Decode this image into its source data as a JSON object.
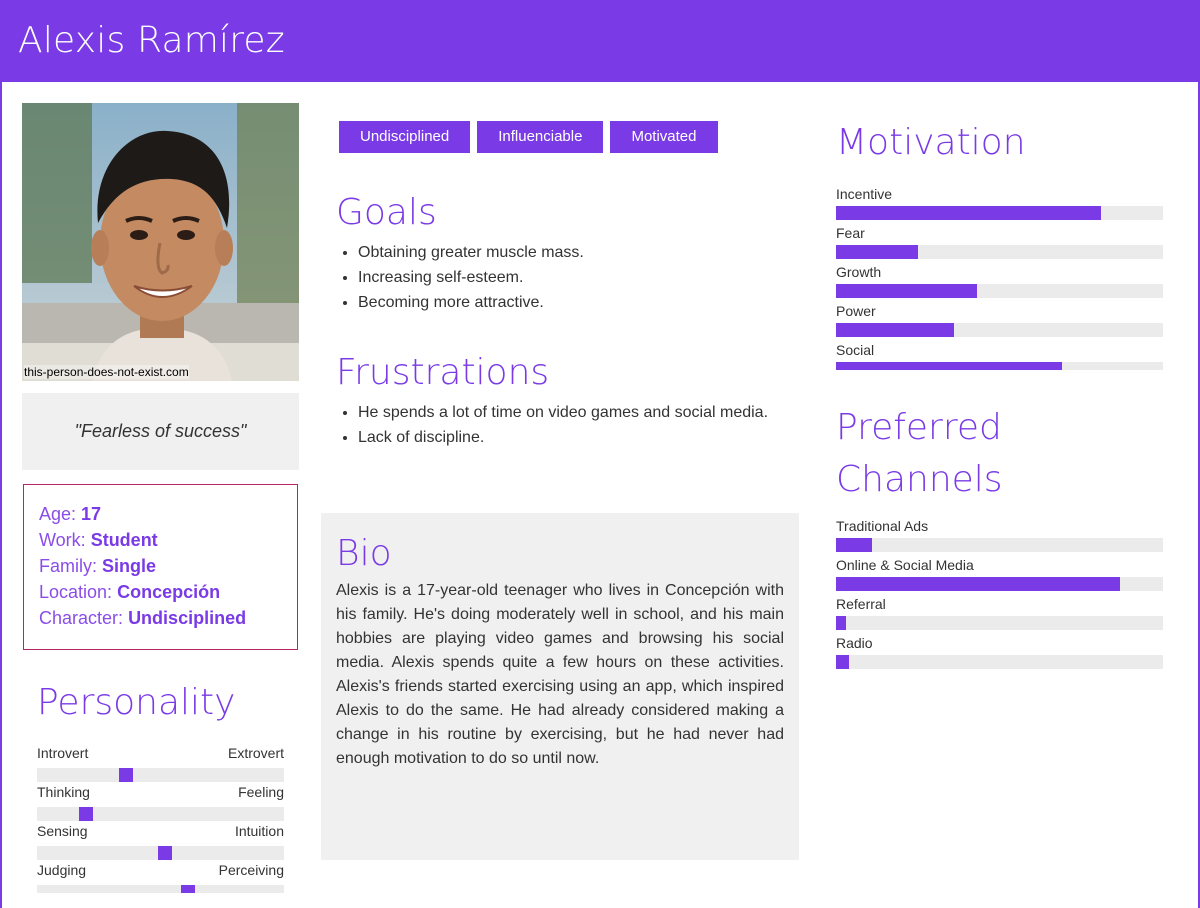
{
  "header": {
    "name": "Alexis Ramírez"
  },
  "photo": {
    "credit": "this-person-does-not-exist.com"
  },
  "quote": "\"Fearless of success\"",
  "facts": [
    {
      "label": "Age:",
      "value": "17"
    },
    {
      "label": "Work:",
      "value": "Student"
    },
    {
      "label": "Family:",
      "value": "Single"
    },
    {
      "label": "Location:",
      "value": "Concepción"
    },
    {
      "label": "Character:",
      "value": "Undisciplined"
    }
  ],
  "personality": {
    "title": "Personality",
    "traits": [
      {
        "left": "Introvert",
        "right": "Extrovert",
        "position": 0.35
      },
      {
        "left": "Thinking",
        "right": "Feeling",
        "position": 0.18
      },
      {
        "left": "Sensing",
        "right": "Intuition",
        "position": 0.52
      },
      {
        "left": "Judging",
        "right": "Perceiving",
        "position": 0.62
      }
    ]
  },
  "tags": [
    "Undisciplined",
    "Influenciable",
    "Motivated"
  ],
  "goals": {
    "title": "Goals",
    "items": [
      "Obtaining greater muscle mass.",
      "Increasing self-esteem.",
      "Becoming more attractive."
    ]
  },
  "frustrations": {
    "title": "Frustrations",
    "items": [
      "He spends a lot of time on video games and social media.",
      "Lack of discipline."
    ]
  },
  "bio": {
    "title": "Bio",
    "text": "Alexis is a 17-year-old teenager who lives in Concepción with his family. He's doing moderately well in school, and his main hobbies are playing video games and browsing his social media. Alexis spends quite a few hours on these activities. Alexis's friends started exercising using an app, which inspired Alexis to do the same. He had already considered making a change in his routine by exercising, but he had never had enough motivation to do so until now."
  },
  "motivation": {
    "title": "Motivation",
    "items": [
      {
        "label": "Incentive",
        "value": 0.81
      },
      {
        "label": "Fear",
        "value": 0.25
      },
      {
        "label": "Growth",
        "value": 0.43
      },
      {
        "label": "Power",
        "value": 0.36
      },
      {
        "label": "Social",
        "value": 0.69
      }
    ]
  },
  "channels": {
    "title": "Preferred Channels",
    "items": [
      {
        "label": "Traditional Ads",
        "value": 0.11
      },
      {
        "label": "Online & Social Media",
        "value": 0.87
      },
      {
        "label": "Referral",
        "value": 0.03
      },
      {
        "label": "Radio",
        "value": 0.04
      }
    ]
  },
  "colors": {
    "accent": "#7a3be6",
    "facts_border": "#b5266b",
    "track": "#ebebeb",
    "panel": "#f0f0f0"
  }
}
